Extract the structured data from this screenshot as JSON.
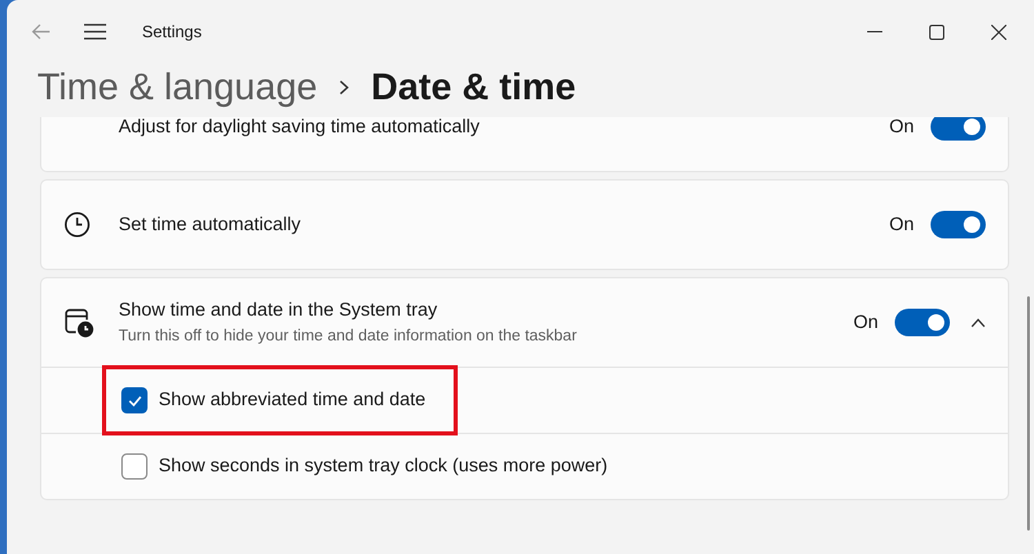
{
  "window": {
    "title": "Settings"
  },
  "breadcrumb": {
    "parent": "Time & language",
    "current": "Date & time"
  },
  "settings": [
    {
      "label": "Adjust for daylight saving time automatically",
      "state_text": "On",
      "on": true
    },
    {
      "label": "Set time automatically",
      "state_text": "On",
      "on": true
    },
    {
      "label": "Show time and date in the System tray",
      "description": "Turn this off to hide your time and date information on the taskbar",
      "state_text": "On",
      "on": true,
      "expanded": true,
      "options": [
        {
          "label": "Show abbreviated time and date",
          "checked": true,
          "highlighted": true
        },
        {
          "label": "Show seconds in system tray clock (uses more power)",
          "checked": false,
          "highlighted": false
        }
      ]
    }
  ]
}
